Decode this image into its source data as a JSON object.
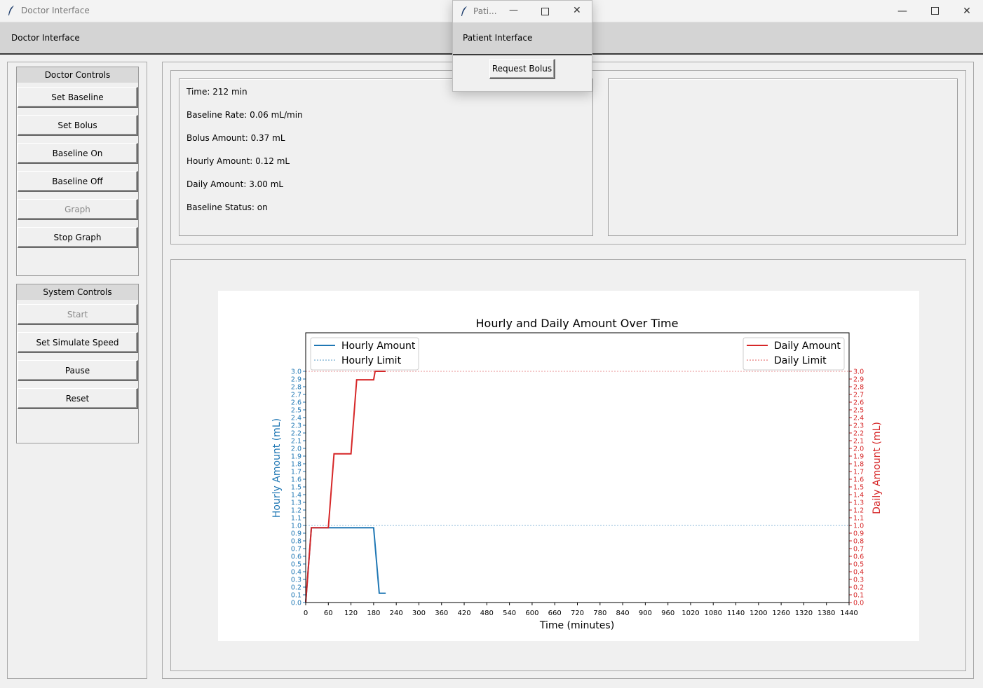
{
  "main_window": {
    "title": "Doctor Interface",
    "header_label": "Doctor Interface"
  },
  "doctor_controls": {
    "title": "Doctor Controls",
    "buttons": [
      {
        "label": "Set Baseline",
        "enabled": true
      },
      {
        "label": "Set Bolus",
        "enabled": true
      },
      {
        "label": "Baseline On",
        "enabled": true
      },
      {
        "label": "Baseline Off",
        "enabled": true
      },
      {
        "label": "Graph",
        "enabled": false
      },
      {
        "label": "Stop Graph",
        "enabled": true
      }
    ]
  },
  "system_controls": {
    "title": "System Controls",
    "buttons": [
      {
        "label": "Start",
        "enabled": false
      },
      {
        "label": "Set Simulate Speed",
        "enabled": true
      },
      {
        "label": "Pause",
        "enabled": true
      },
      {
        "label": "Reset",
        "enabled": true
      }
    ]
  },
  "status": {
    "time": "Time: 212 min",
    "baseline_rate": "Baseline Rate: 0.06 mL/min",
    "bolus_amount": "Bolus Amount: 0.37 mL",
    "hourly_amount": "Hourly Amount: 0.12 mL",
    "daily_amount": "Daily Amount: 3.00 mL",
    "baseline_status": "Baseline Status: on"
  },
  "patient_window": {
    "title": "Pati...",
    "header_label": "Patient Interface",
    "request_bolus_label": "Request Bolus"
  },
  "colors": {
    "hourly": "#1f77b4",
    "daily": "#d62728"
  },
  "chart_data": {
    "type": "line",
    "title": "Hourly and Daily Amount Over Time",
    "xlabel": "Time (minutes)",
    "ylabel_left": "Hourly Amount (mL)",
    "ylabel_right": "Daily Amount (mL)",
    "xlim": [
      0,
      1440
    ],
    "ylim": [
      0,
      3.0
    ],
    "xticks": [
      0,
      60,
      120,
      180,
      240,
      300,
      360,
      420,
      480,
      540,
      600,
      660,
      720,
      780,
      840,
      900,
      960,
      1020,
      1080,
      1140,
      1200,
      1260,
      1320,
      1380,
      1440
    ],
    "yticks": [
      0.0,
      0.1,
      0.2,
      0.3,
      0.4,
      0.5,
      0.6,
      0.7,
      0.8,
      0.9,
      1.0,
      1.1,
      1.2,
      1.3,
      1.4,
      1.5,
      1.6,
      1.7,
      1.8,
      1.9,
      2.0,
      2.1,
      2.2,
      2.3,
      2.4,
      2.5,
      2.6,
      2.7,
      2.8,
      2.9,
      3.0
    ],
    "grid": false,
    "legend_left": [
      {
        "label": "Hourly Amount",
        "style": "solid"
      },
      {
        "label": "Hourly Limit",
        "style": "dashed"
      }
    ],
    "legend_right": [
      {
        "label": "Daily Amount",
        "style": "solid"
      },
      {
        "label": "Daily Limit",
        "style": "dashed"
      }
    ],
    "series": [
      {
        "name": "Hourly Amount",
        "axis": "left",
        "x": [
          0,
          15,
          180,
          195,
          212
        ],
        "y": [
          0.0,
          0.97,
          0.97,
          0.12,
          0.12
        ]
      },
      {
        "name": "Daily Amount",
        "axis": "right",
        "x": [
          0,
          15,
          60,
          75,
          120,
          135,
          180,
          184,
          212
        ],
        "y": [
          0.0,
          0.97,
          0.97,
          1.93,
          1.93,
          2.89,
          2.89,
          3.0,
          3.0
        ]
      }
    ],
    "limits": [
      {
        "name": "Hourly Limit",
        "axis": "left",
        "value": 1.0
      },
      {
        "name": "Daily Limit",
        "axis": "right",
        "value": 3.0
      }
    ]
  }
}
